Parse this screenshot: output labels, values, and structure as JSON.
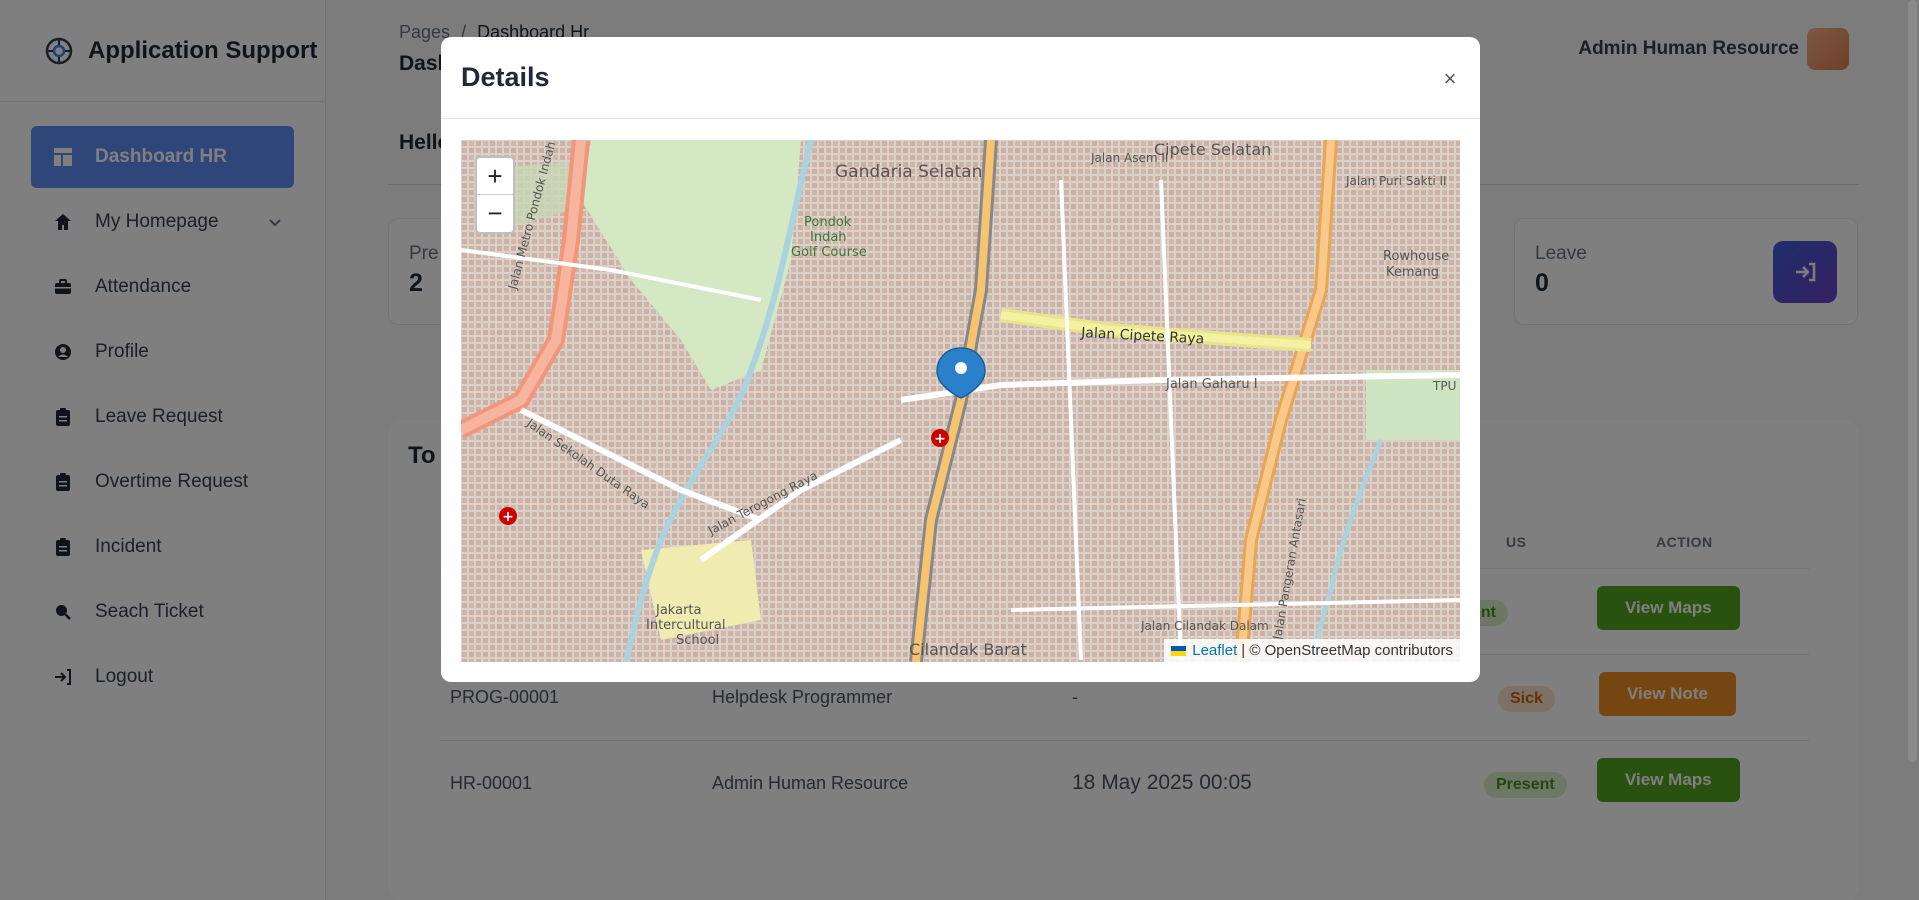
{
  "app": {
    "title": "Application Support"
  },
  "sidebar": {
    "items": [
      {
        "label": "Dashboard HR",
        "icon": "dashboard-icon",
        "active": true
      },
      {
        "label": "My Homepage",
        "icon": "home-icon",
        "has_dropdown": true
      },
      {
        "label": "Attendance",
        "icon": "briefcase-icon"
      },
      {
        "label": "Profile",
        "icon": "user-circle-icon"
      },
      {
        "label": "Leave Request",
        "icon": "clipboard-icon"
      },
      {
        "label": "Overtime Request",
        "icon": "clipboard-icon"
      },
      {
        "label": "Incident",
        "icon": "clipboard-icon"
      },
      {
        "label": "Seach Ticket",
        "icon": "search-icon"
      },
      {
        "label": "Logout",
        "icon": "logout-icon"
      }
    ]
  },
  "header": {
    "breadcrumb": {
      "parent": "Pages",
      "separator": "/",
      "current": "Dashboard Hr"
    },
    "page_title": "Dash",
    "user_name": "Admin Human Resource"
  },
  "main": {
    "greeting": "Hello",
    "stats": [
      {
        "label": "Pre",
        "value": "2"
      },
      {
        "label": "Leave",
        "value": "0"
      }
    ],
    "table": {
      "title": "To",
      "headers": {
        "status": "US",
        "action": "ACTION"
      },
      "rows": [
        {
          "id": "",
          "name": "",
          "time": "",
          "status": "ent",
          "status_type": "present",
          "action": "View Maps"
        },
        {
          "id": "PROG-00001",
          "name": "Helpdesk Programmer",
          "time": "-",
          "status": "Sick",
          "status_type": "sick",
          "action": "View Note"
        },
        {
          "id": "HR-00001",
          "name": "Admin Human Resource",
          "time": "18 May 2025 00:05",
          "status": "Present",
          "status_type": "present",
          "action": "View Maps"
        }
      ]
    }
  },
  "modal": {
    "title": "Details",
    "close_label": "×",
    "map": {
      "zoom_in": "+",
      "zoom_out": "−",
      "attribution_leaflet": "Leaflet",
      "attribution_osm": "| © OpenStreetMap contributors",
      "labels": [
        "Gandaria Selatan",
        "Cipete Selatan",
        "Pondok",
        "Indah",
        "Golf Course",
        "Rowhouse",
        "Kemang",
        "Jalan Cipete Raya",
        "Jalan Gaharu I",
        "Jakarta",
        "Intercultural",
        "School",
        "Cilandak Barat",
        "Jalan Cilandak Dalam",
        "Jalan Terogong Raya",
        "Jalan Sekolah Duta Raya",
        "Jalan Metro Pondok Indah",
        "Jalan Pangeran Antasari",
        "Jalan Asem II",
        "Jalan Puri Sakti II",
        "TPU"
      ]
    }
  },
  "colors": {
    "sidebar_active": "#5e8df5",
    "present_badge": "#d9f0c9",
    "sick_badge": "#fbe2cc",
    "green_button": "#52a31f",
    "orange_button": "#eb8a24"
  }
}
